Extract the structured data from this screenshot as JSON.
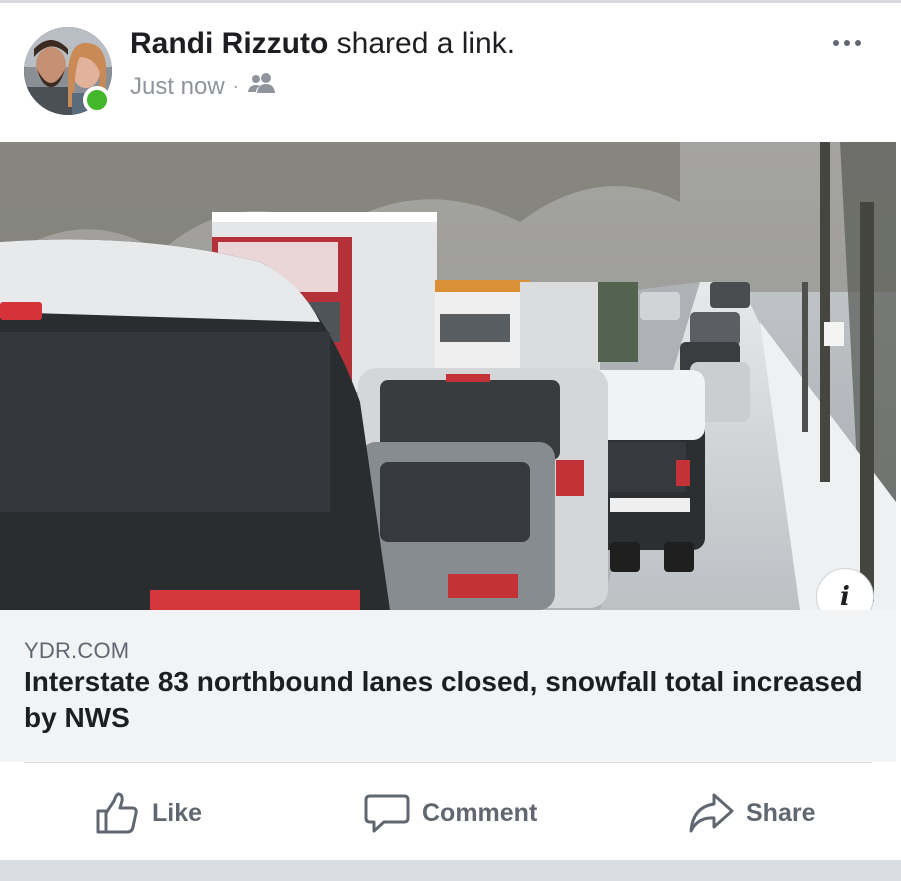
{
  "post": {
    "author": "Randi Rizzuto",
    "action_text": " shared a link.",
    "timestamp": "Just now",
    "separator": "·",
    "audience_icon": "friends-icon",
    "more_icon": "more-horizontal-icon"
  },
  "link": {
    "image_icon": "snowy-traffic-photo",
    "info_label": "i",
    "domain": "YDR.COM",
    "headline": "Interstate 83 northbound lanes closed, snowfall total increased by NWS"
  },
  "actions": {
    "like": "Like",
    "comment": "Comment",
    "share": "Share"
  },
  "colors": {
    "online": "#42b72a",
    "text_primary": "#1c1e21",
    "text_secondary": "#606770",
    "caption_bg": "#f2f3f5"
  }
}
